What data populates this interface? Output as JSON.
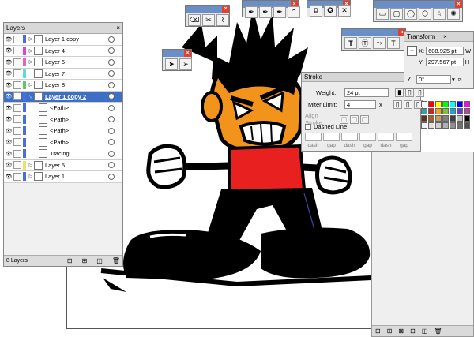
{
  "layers_panel": {
    "title": "Layers",
    "footer_count": "8 Layers",
    "rows": [
      {
        "name": "Layer 1 copy",
        "color": "#4a6ee0",
        "expander": "▷"
      },
      {
        "name": "Layer 4",
        "color": "#e040e0",
        "expander": "▷"
      },
      {
        "name": "Layer 6",
        "color": "#f060b0",
        "expander": "▷"
      },
      {
        "name": "Layer 7",
        "color": "#60d8e8",
        "expander": ""
      },
      {
        "name": "Layer 8",
        "color": "#60c860",
        "expander": "▷"
      },
      {
        "name": "Layer 1 copy 2",
        "color": "#4a6ee0",
        "expander": "▽"
      },
      {
        "name": "<Path>",
        "color": "#4a6ee0",
        "expander": ""
      },
      {
        "name": "<Path>",
        "color": "#4a6ee0",
        "expander": ""
      },
      {
        "name": "<Path>",
        "color": "#4a6ee0",
        "expander": ""
      },
      {
        "name": "<Path>",
        "color": "#4a6ee0",
        "expander": ""
      },
      {
        "name": "Tracing",
        "color": "#4a6ee0",
        "expander": ""
      },
      {
        "name": "Layer 5",
        "color": "#f0e060",
        "expander": "▷"
      },
      {
        "name": "Layer 1",
        "color": "#4a6ee0",
        "expander": "▷"
      }
    ]
  },
  "stroke_panel": {
    "title": "Stroke",
    "weight_label": "Weight:",
    "weight_value": "24 pt",
    "miter_label": "Miter Limit:",
    "miter_value": "4",
    "miter_unit": "x",
    "align_label": "Align Stroke:",
    "dashed_label": "Dashed Line",
    "dash_labels": [
      "dash",
      "gap",
      "dash",
      "gap",
      "dash",
      "gap"
    ]
  },
  "transform_panel": {
    "title": "Transform",
    "x_label": "X:",
    "x_value": "608.925 pt",
    "y_label": "Y:",
    "y_value": "297.567 pt",
    "angle_value": "0°",
    "w_label": "W",
    "h_label": "H"
  },
  "icons": [
    "close-icon",
    "eraser-icon",
    "scissors-icon",
    "knife-icon",
    "pen-icon",
    "add-anchor-icon",
    "delete-anchor-icon",
    "convert-anchor-icon",
    "selection-icon",
    "direct-selection-icon",
    "type-icon",
    "area-type-icon",
    "path-type-icon",
    "vertical-type-icon",
    "rectangle-icon",
    "rounded-rect-icon",
    "ellipse-icon",
    "polygon-icon",
    "star-icon",
    "flare-icon"
  ],
  "colors": {
    "face": "#f2931b",
    "shirt": "#e82020",
    "ink": "#000000",
    "panel_tab": "#6a8fc7",
    "selected_row": "#3d6fc4"
  }
}
